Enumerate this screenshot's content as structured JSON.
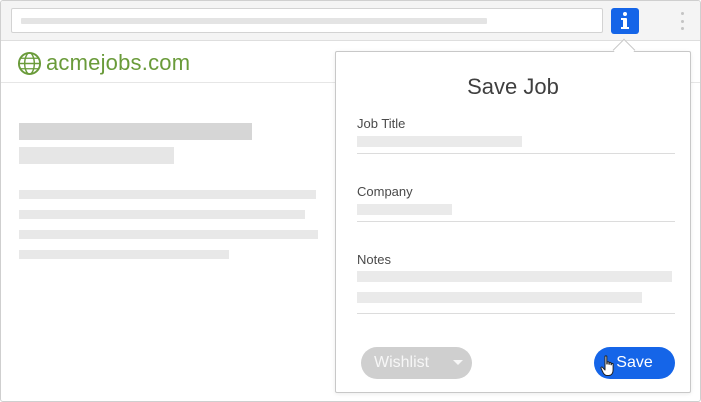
{
  "browser": {
    "extension_icon": "info-icon",
    "menu_icon": "vertical-dots-icon",
    "accent": "#1565e8"
  },
  "site": {
    "logo_text": "acmejobs.com",
    "logo_icon": "globe-icon",
    "logo_color": "#6a9b3a"
  },
  "popup": {
    "title": "Save Job",
    "fields": {
      "job_title": {
        "label": "Job Title"
      },
      "company": {
        "label": "Company"
      },
      "notes": {
        "label": "Notes"
      }
    },
    "wishlist": {
      "selected": "Wishlist"
    },
    "save_label": "Save",
    "cursor_icon": "hand-pointer-icon"
  }
}
